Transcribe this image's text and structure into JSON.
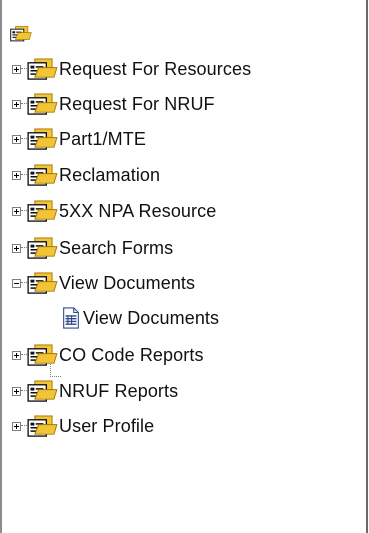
{
  "tree": {
    "items": [
      {
        "label": "Request For Resources",
        "state": "collapsed"
      },
      {
        "label": "Request For NRUF",
        "state": "collapsed"
      },
      {
        "label": "Part1/MTE",
        "state": "collapsed"
      },
      {
        "label": "Reclamation",
        "state": "collapsed"
      },
      {
        "label": "5XX NPA Resource",
        "state": "collapsed"
      },
      {
        "label": "Search Forms",
        "state": "collapsed"
      },
      {
        "label": "View Documents",
        "state": "expanded",
        "children": [
          {
            "label": "View Documents",
            "icon": "document-icon"
          }
        ]
      },
      {
        "label": "CO Code Reports",
        "state": "collapsed"
      },
      {
        "label": "NRUF Reports",
        "state": "collapsed"
      },
      {
        "label": "User Profile",
        "state": "collapsed"
      }
    ],
    "icons": {
      "folder": "folder-doc-icon",
      "document": "document-icon",
      "root": "root-folder-icon"
    },
    "colors": {
      "folder_fill": "#f2c437",
      "folder_dark": "#b78500",
      "doc_blue": "#2f4c8a",
      "text": "#111111"
    }
  }
}
